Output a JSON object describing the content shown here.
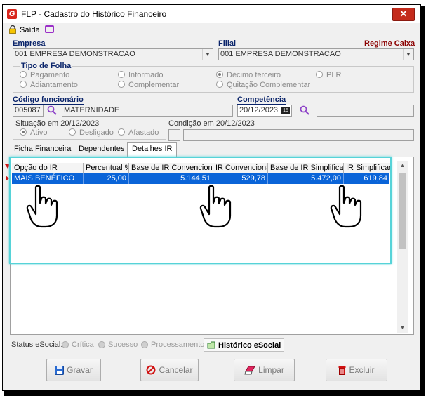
{
  "window": {
    "title": "FLP - Cadastro do Histórico Financeiro",
    "close_label": "✕"
  },
  "toolbar": {
    "saida_label": "Saída"
  },
  "empresa": {
    "label": "Empresa",
    "value": "001 EMPRESA DEMONSTRACAO"
  },
  "filial": {
    "label": "Filial",
    "value": "001 EMPRESA DEMONSTRACAO"
  },
  "regime": {
    "label": "Regime Caixa",
    "color": "#8b0000"
  },
  "tipo_folha": {
    "title": "Tipo de Folha",
    "options": [
      "Pagamento",
      "Informado",
      "Décimo terceiro",
      "PLR",
      "Adiantamento",
      "Complementar",
      "Quitação Complementar"
    ],
    "selected": "Décimo terceiro"
  },
  "funcionario": {
    "label": "Código funcionário",
    "code": "005087",
    "name": "MATERNIDADE"
  },
  "competencia": {
    "label": "Competência",
    "value": "20/12/2023",
    "calendar_badge": "15"
  },
  "situacao": {
    "title": "Situação em 20/12/2023",
    "options": [
      "Ativo",
      "Desligado",
      "Afastado"
    ],
    "selected": "Ativo"
  },
  "condicao": {
    "title": "Condição em 20/12/2023"
  },
  "tabs": [
    "Ficha Financeira",
    "Dependentes",
    "Detalhes IR"
  ],
  "active_tab": "Detalhes IR",
  "grid": {
    "columns": [
      "Opção do IR",
      "Percentual %",
      "Base de IR Convencional",
      "IR Convencional",
      "Base de IR Simplificado",
      "IR Simplificado"
    ],
    "rows": [
      {
        "opcao": "MAIS BENÉFICO",
        "percentual": "25,00",
        "base_conv": "5.144,51",
        "ir_conv": "529,78",
        "base_simp": "5.472,00",
        "ir_simp": "619,84"
      }
    ],
    "selected_color": "#0a64d8"
  },
  "status": {
    "label": "Status eSocial:",
    "items": [
      "Crítica",
      "Sucesso",
      "Processamento"
    ],
    "historico_label": "Histórico eSocial"
  },
  "buttons": {
    "gravar": "Gravar",
    "cancelar": "Cancelar",
    "limpar": "Limpar",
    "excluir": "Excluir"
  },
  "icons": [
    "app-logo-icon",
    "close-icon",
    "lock-icon",
    "monitor-icon",
    "search-icon",
    "calendar-icon",
    "hand-pointer-icon",
    "disk-icon",
    "cancel-icon",
    "eraser-icon",
    "trash-icon",
    "history-icon"
  ]
}
